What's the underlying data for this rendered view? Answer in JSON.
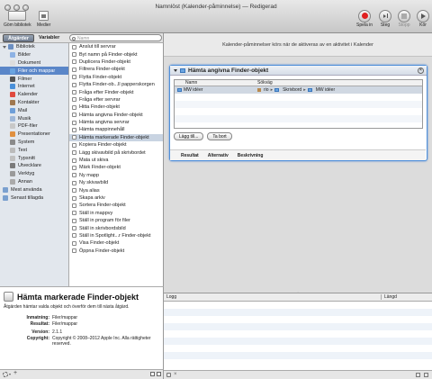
{
  "window": {
    "title": "Namnlöst (Kalender-påminnelse) — Redigerad"
  },
  "toolbar": {
    "library_label": "Göm bibliotek",
    "media_label": "Medier",
    "record_label": "Spela in",
    "step_label": "Steg",
    "stop_label": "Stopp",
    "run_label": "Kör"
  },
  "tabs": {
    "actions": "Åtgärder",
    "variables": "Variabler"
  },
  "search": {
    "placeholder": "Namn"
  },
  "library": [
    {
      "label": "Bibliotek",
      "color": "#6b8fc2",
      "indent": 0,
      "disc": true
    },
    {
      "label": "Bilder",
      "color": "#8db2e4",
      "indent": 1
    },
    {
      "label": "Dokument",
      "color": "#dddddd",
      "indent": 1
    },
    {
      "label": "Filer och mappar",
      "color": "#6aa4e0",
      "indent": 1,
      "selected": true
    },
    {
      "label": "Filmer",
      "color": "#555555",
      "indent": 1
    },
    {
      "label": "Internet",
      "color": "#4a90d9",
      "indent": 1
    },
    {
      "label": "Kalender",
      "color": "#e04a3f",
      "indent": 1
    },
    {
      "label": "Kontakter",
      "color": "#a07850",
      "indent": 1
    },
    {
      "label": "Mail",
      "color": "#6f9fd8",
      "indent": 1
    },
    {
      "label": "Musik",
      "color": "#a0b8d8",
      "indent": 1
    },
    {
      "label": "PDF-filer",
      "color": "#c8c8c8",
      "indent": 1
    },
    {
      "label": "Presentationer",
      "color": "#e09040",
      "indent": 1
    },
    {
      "label": "System",
      "color": "#8a8a8a",
      "indent": 1
    },
    {
      "label": "Text",
      "color": "#bbbbbb",
      "indent": 1
    },
    {
      "label": "Typsnitt",
      "color": "#c0c0c0",
      "indent": 1
    },
    {
      "label": "Utvecklare",
      "color": "#7a7a7a",
      "indent": 1
    },
    {
      "label": "Verktyg",
      "color": "#9a9a9a",
      "indent": 1
    },
    {
      "label": "Annan",
      "color": "#aaaaaa",
      "indent": 1
    },
    {
      "label": "Mest använda",
      "color": "#7aa0cf",
      "indent": 0
    },
    {
      "label": "Senast tillagda",
      "color": "#7aa0cf",
      "indent": 0
    }
  ],
  "actions": [
    {
      "label": "Anslut till servrar"
    },
    {
      "label": "Byt namn på Finder-objekt"
    },
    {
      "label": "Duplicera Finder-objekt"
    },
    {
      "label": "Filtrera Finder-objekt"
    },
    {
      "label": "Flytta Finder-objekt"
    },
    {
      "label": "Flytta Finder-ob...ll papperskorgen"
    },
    {
      "label": "Fråga efter Finder-objekt"
    },
    {
      "label": "Fråga efter servrar"
    },
    {
      "label": "Hitta Finder-objekt"
    },
    {
      "label": "Hämta angivna Finder-objekt"
    },
    {
      "label": "Hämta angivna servrar"
    },
    {
      "label": "Hämta mappinnehåll"
    },
    {
      "label": "Hämta markerade Finder-objekt",
      "selected": true
    },
    {
      "label": "Kopiera Finder-objekt"
    },
    {
      "label": "Lägg skivavbild på skrivbordet"
    },
    {
      "label": "Mata ut skiva"
    },
    {
      "label": "Märk Finder-objekt"
    },
    {
      "label": "Ny mapp"
    },
    {
      "label": "Ny skivavbild"
    },
    {
      "label": "Nya alias"
    },
    {
      "label": "Skapa arkiv"
    },
    {
      "label": "Sortera Finder-objekt"
    },
    {
      "label": "Ställ in mappvy"
    },
    {
      "label": "Ställ in program för filer"
    },
    {
      "label": "Ställ in skrivbordsbild"
    },
    {
      "label": "Ställ in Spotlight...r Finder-objekt"
    },
    {
      "label": "Visa Finder-objekt"
    },
    {
      "label": "Öppna Finder-objekt"
    }
  ],
  "description": {
    "title": "Hämta markerade Finder-objekt",
    "text": "Åtgärden hämtar valda objekt och överför dem till nästa åtgärd.",
    "input_key": "Inmatning:",
    "input_val": "Filer/mappar",
    "result_key": "Resultat:",
    "result_val": "Filer/mappar",
    "version_key": "Version:",
    "version_val": "2.1.1",
    "copyright_key": "Copyright:",
    "copyright_val": "Copyright © 2008–2012 Apple Inc. Alla rättigheter reserved."
  },
  "workflow": {
    "banner": "Kalender-påminnelser körs när de aktiveras av en aktivitet i Kalender",
    "card_title": "Hämta angivna Finder-objekt",
    "col_name": "Namn",
    "col_path": "Sökväg",
    "row_name": "MW idéer",
    "path": [
      "rio",
      "Skrivbord",
      "MW idéer"
    ],
    "add_button": "Lägg till...",
    "remove_button": "Ta bort",
    "footer_tabs": [
      "Resultat",
      "Alternativ",
      "Beskrivning"
    ]
  },
  "log": {
    "col_log": "Logg",
    "col_length": "Längd"
  }
}
